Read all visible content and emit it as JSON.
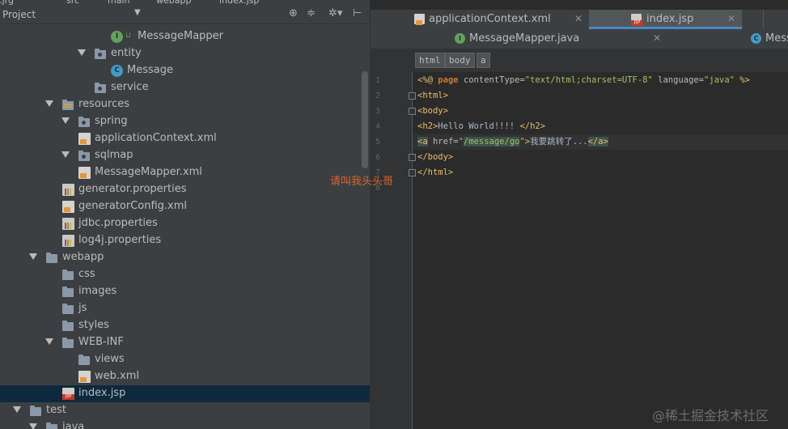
{
  "breadcrumbs": {
    "items": [
      "test.jrg",
      "src",
      "main",
      "webapp",
      "index.jsp"
    ]
  },
  "project_panel": {
    "title": "Project",
    "header_icons": [
      "target-icon",
      "collapse-all-icon",
      "settings-gear-icon",
      "hide-panel-icon"
    ]
  },
  "tree": [
    {
      "label": "MessageMapper",
      "kind": "interface",
      "expanded": null,
      "selected": false
    },
    {
      "label": "entity",
      "kind": "package",
      "expanded": true,
      "selected": false
    },
    {
      "label": "Message",
      "kind": "class",
      "expanded": null,
      "selected": false
    },
    {
      "label": "service",
      "kind": "package",
      "expanded": null,
      "selected": false
    },
    {
      "label": "resources",
      "kind": "resource-folder",
      "expanded": true,
      "selected": false
    },
    {
      "label": "spring",
      "kind": "package",
      "expanded": true,
      "selected": false
    },
    {
      "label": "applicationContext.xml",
      "kind": "xml",
      "expanded": null,
      "selected": false
    },
    {
      "label": "sqlmap",
      "kind": "package",
      "expanded": true,
      "selected": false
    },
    {
      "label": "MessageMapper.xml",
      "kind": "xml",
      "expanded": null,
      "selected": false
    },
    {
      "label": "generator.properties",
      "kind": "properties",
      "expanded": null,
      "selected": false
    },
    {
      "label": "generatorConfig.xml",
      "kind": "xml",
      "expanded": null,
      "selected": false
    },
    {
      "label": "jdbc.properties",
      "kind": "properties",
      "expanded": null,
      "selected": false
    },
    {
      "label": "log4j.properties",
      "kind": "properties",
      "expanded": null,
      "selected": false
    },
    {
      "label": "webapp",
      "kind": "folder",
      "expanded": true,
      "selected": false
    },
    {
      "label": "css",
      "kind": "folder",
      "expanded": null,
      "selected": false
    },
    {
      "label": "images",
      "kind": "folder",
      "expanded": null,
      "selected": false
    },
    {
      "label": "js",
      "kind": "folder",
      "expanded": null,
      "selected": false
    },
    {
      "label": "styles",
      "kind": "folder",
      "expanded": null,
      "selected": false
    },
    {
      "label": "WEB-INF",
      "kind": "folder",
      "expanded": true,
      "selected": false
    },
    {
      "label": "views",
      "kind": "folder",
      "expanded": null,
      "selected": false
    },
    {
      "label": "web.xml",
      "kind": "xml",
      "expanded": null,
      "selected": false
    },
    {
      "label": "index.jsp",
      "kind": "jsp",
      "expanded": null,
      "selected": true
    },
    {
      "label": "test",
      "kind": "folder",
      "expanded": true,
      "selected": false
    },
    {
      "label": "java",
      "kind": "folder",
      "expanded": true,
      "selected": false
    }
  ],
  "editor_tabs_row1": [
    {
      "label": "applicationContext.xml",
      "icon": "xml-file-icon",
      "active": false
    },
    {
      "label": "index.jsp",
      "icon": "jsp-file-icon",
      "active": true
    }
  ],
  "editor_tabs_row2": [
    {
      "label": "MessageMapper.java",
      "icon": "interface-icon",
      "active": false
    },
    {
      "label": "Mess",
      "icon": "class-icon",
      "active": false
    }
  ],
  "tag_breadcrumbs": [
    "html",
    "body",
    "a"
  ],
  "code_lines": [
    {
      "n": "1",
      "tokens": [
        [
          "tg",
          "<%@ "
        ],
        [
          "kw",
          "page"
        ],
        [
          "at",
          " contentType="
        ],
        [
          "vl",
          "\"text/html;charset=UTF-8\""
        ],
        [
          "at",
          " language="
        ],
        [
          "vl",
          "\"java\""
        ],
        [
          "tg",
          " %>"
        ]
      ]
    },
    {
      "n": "2",
      "tokens": [
        [
          "tg",
          "<html>"
        ]
      ]
    },
    {
      "n": "3",
      "tokens": [
        [
          "tg",
          "<body>"
        ]
      ]
    },
    {
      "n": "4",
      "tokens": [
        [
          "tg",
          "<h2>"
        ],
        [
          "tx",
          "Hello World!!!! "
        ],
        [
          "tg",
          "</h2>"
        ]
      ]
    },
    {
      "n": "5",
      "tokens": [
        [
          "tgh",
          "<a"
        ],
        [
          "at",
          " href="
        ],
        [
          "vl",
          "\""
        ],
        [
          "vlh",
          "/message/go"
        ],
        [
          "vl",
          "\""
        ],
        [
          "tg",
          ">"
        ],
        [
          "tx",
          "我要跳转了..."
        ],
        [
          "tgh",
          "</a>"
        ]
      ]
    },
    {
      "n": "6",
      "tokens": [
        [
          "tg",
          "</body>"
        ]
      ]
    },
    {
      "n": "7",
      "tokens": [
        [
          "tg",
          "</html>"
        ]
      ]
    },
    {
      "n": "8",
      "tokens": []
    }
  ],
  "annotation": "请叫我头头哥",
  "watermark": "@稀土掘金技术社区"
}
